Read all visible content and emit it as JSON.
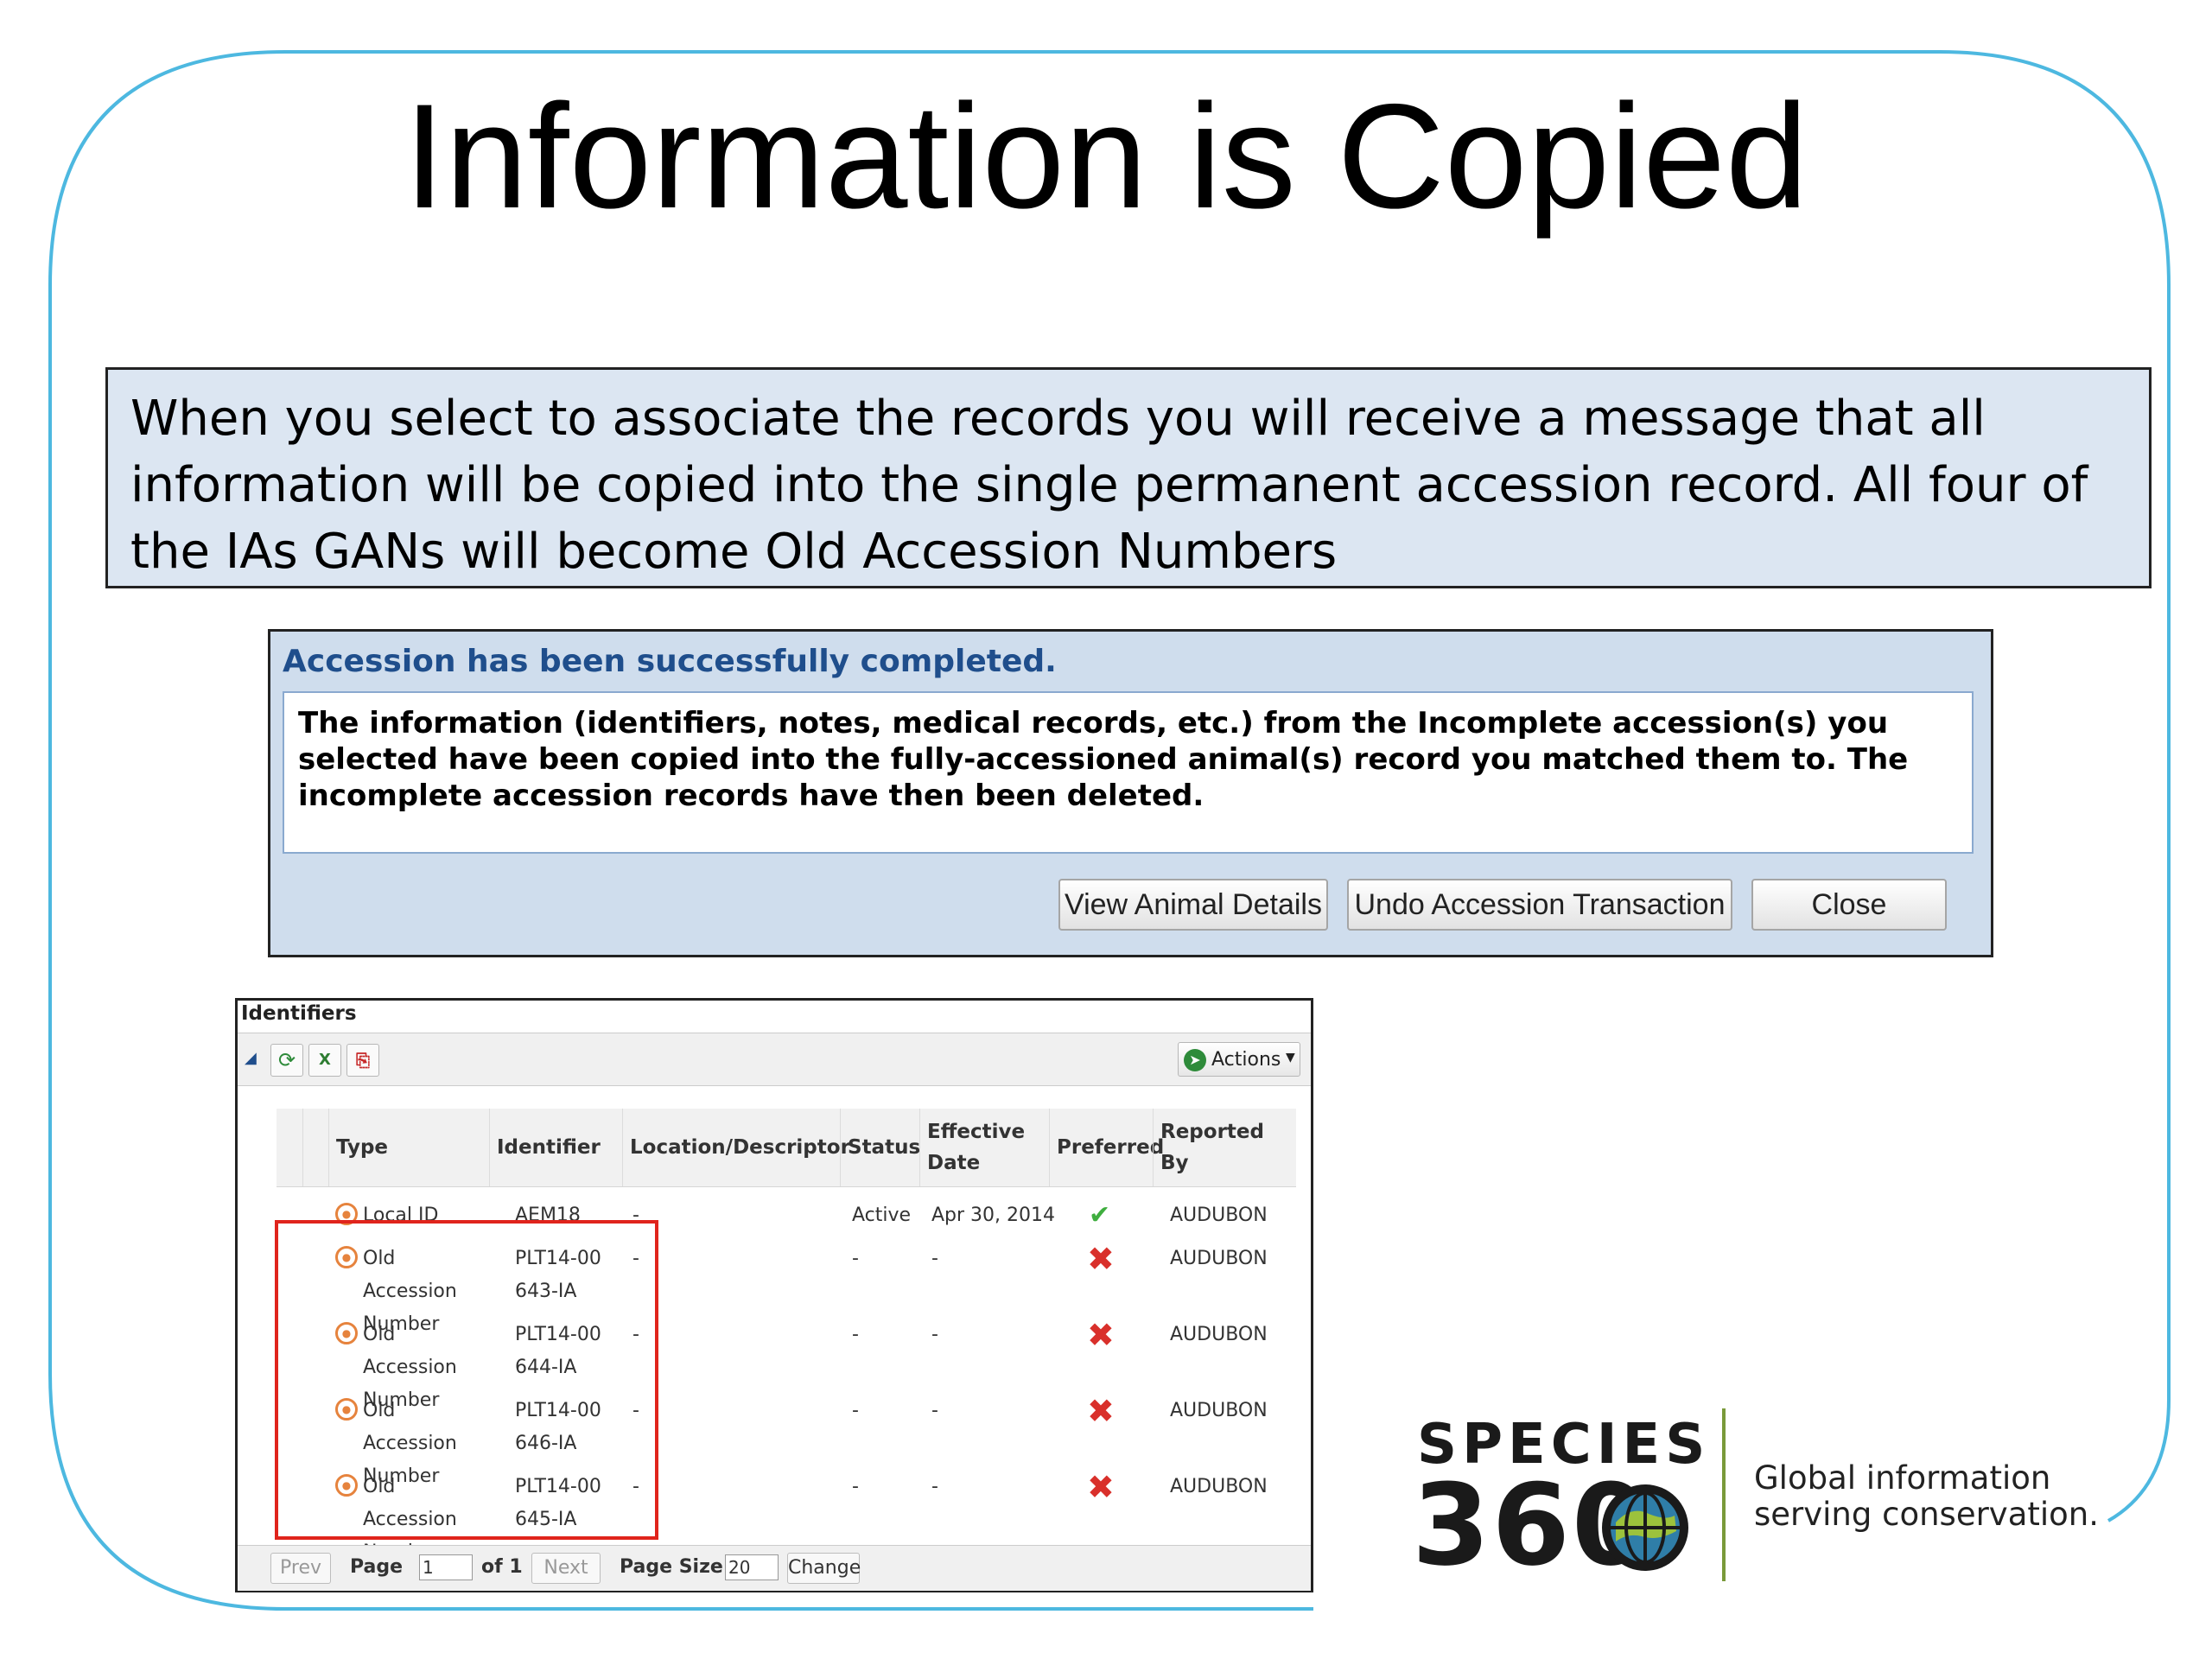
{
  "slide": {
    "title": "Information is Copied",
    "description": "When you select to associate the records you will receive a message that all information will be copied into the single permanent accession record. All four of the IAs GANs will become Old Accession Numbers"
  },
  "dialog": {
    "title": "Accession has been successfully completed.",
    "message": "The information (identifiers, notes, medical records, etc.) from the Incomplete accession(s) you selected have been copied into the fully-accessioned animal(s) record you matched them to. The incomplete accession records have then been deleted.",
    "buttons": {
      "view": "View Animal Details",
      "undo": "Undo Accession Transaction",
      "close": "Close"
    }
  },
  "identifiers": {
    "panel_title": "Identifiers",
    "actions_label": "Actions",
    "columns": [
      "Type",
      "Identifier",
      "Location/Descriptor",
      "Status",
      "Effective Date",
      "Preferred",
      "Reported By"
    ],
    "rows": [
      {
        "type": "Local ID",
        "identifier": "AEM18",
        "location": "-",
        "status": "Active",
        "date": "Apr 30, 2014",
        "preferred": "yes",
        "reported_by": "AUDUBON"
      },
      {
        "type": "Old Accession Number",
        "identifier": "PLT14-00643-IA",
        "location": "-",
        "status": "-",
        "date": "-",
        "preferred": "no",
        "reported_by": "AUDUBON"
      },
      {
        "type": "Old Accession Number",
        "identifier": "PLT14-00644-IA",
        "location": "-",
        "status": "-",
        "date": "-",
        "preferred": "no",
        "reported_by": "AUDUBON"
      },
      {
        "type": "Old Accession Number",
        "identifier": "PLT14-00646-IA",
        "location": "-",
        "status": "-",
        "date": "-",
        "preferred": "no",
        "reported_by": "AUDUBON"
      },
      {
        "type": "Old Accession Number",
        "identifier": "PLT14-00645-IA",
        "location": "-",
        "status": "-",
        "date": "-",
        "preferred": "no",
        "reported_by": "AUDUBON"
      }
    ],
    "pager": {
      "prev": "Prev",
      "page_label": "Page",
      "page_value": "1",
      "of_label": "of 1",
      "next": "Next",
      "page_size_label": "Page Size",
      "page_size_value": "20",
      "change": "Change"
    }
  },
  "logo": {
    "line1": "SPECIES",
    "line2": "360",
    "tagline1": "Global information",
    "tagline2": "serving conservation."
  },
  "colors": {
    "frame_border": "#4db8e0",
    "callout_bg": "#dce6f2",
    "dialog_bg": "#cfdded",
    "highlight_box": "#e0241c",
    "check": "#3fae3f",
    "x_mark": "#d9302b"
  }
}
